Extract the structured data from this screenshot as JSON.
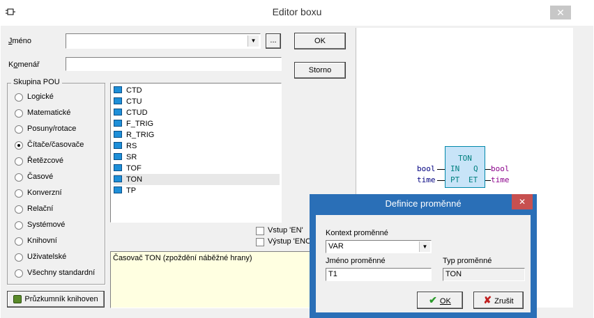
{
  "window": {
    "title": "Editor boxu",
    "close_glyph": "✕"
  },
  "form": {
    "jmeno_label": "Jméno",
    "jmeno_value": "",
    "browse_label": "...",
    "komentar_label": "Komenář",
    "komentar_value": "",
    "ok_label": "OK",
    "storno_label": "Storno"
  },
  "pou_group": {
    "title": "Skupina POU",
    "items": [
      {
        "label": "Logické",
        "selected": false
      },
      {
        "label": "Matematické",
        "selected": false
      },
      {
        "label": "Posuny/rotace",
        "selected": false
      },
      {
        "label": "Čítače/časovače",
        "selected": true
      },
      {
        "label": "Řetězcové",
        "selected": false
      },
      {
        "label": "Časové",
        "selected": false
      },
      {
        "label": "Konverzní",
        "selected": false
      },
      {
        "label": "Relační",
        "selected": false
      },
      {
        "label": "Systémové",
        "selected": false
      },
      {
        "label": "Knihovní",
        "selected": false
      },
      {
        "label": "Uživatelské",
        "selected": false
      },
      {
        "label": "Všechny standardní",
        "selected": false
      }
    ]
  },
  "pou_list": {
    "items": [
      "CTD",
      "CTU",
      "CTUD",
      "F_TRIG",
      "R_TRIG",
      "RS",
      "SR",
      "TOF",
      "TON",
      "TP"
    ],
    "selected": "TON"
  },
  "options": {
    "vstup_en": "Vstup 'EN'",
    "vystup_eno": "Výstup 'ENO"
  },
  "description": "Časovač TON (zpoždění náběžné hrany)",
  "library_button": "Průzkumník knihoven",
  "preview": {
    "block_name": "TON",
    "inputs": [
      {
        "type": "bool",
        "pin": "IN"
      },
      {
        "type": "time",
        "pin": "PT"
      }
    ],
    "outputs": [
      {
        "type": "bool",
        "pin": "Q"
      },
      {
        "type": "time",
        "pin": "ET"
      }
    ],
    "colors": {
      "block_fill": "#c8e4f8",
      "block_border": "#0088aa",
      "type_in": "#000080",
      "type_out": "#8b008b",
      "pin": "#008080"
    }
  },
  "dialog": {
    "title": "Definice proměnné",
    "close_glyph": "✕",
    "kontext_label": "Kontext proměnné",
    "kontext_value": "VAR",
    "jmeno_label": "Jméno proměnné",
    "jmeno_value": "T1",
    "typ_label": "Typ proměnné",
    "typ_value": "TON",
    "ok_label": "OK",
    "zrusit_label": "Zrušit",
    "colors": {
      "title_bar": "#2a6fb7",
      "close": "#c75050"
    }
  }
}
